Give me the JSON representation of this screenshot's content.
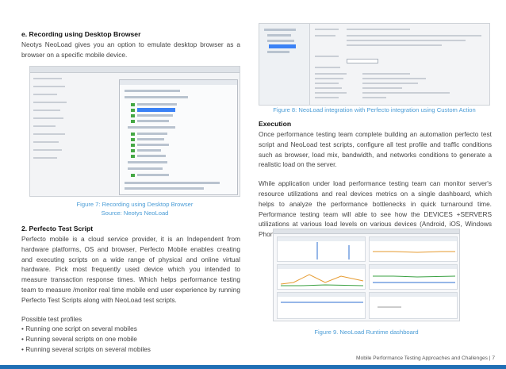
{
  "left": {
    "section_e_title": "e. Recording using Desktop Browser",
    "section_e_body": "Neotys NeoLoad gives you an option to emulate desktop browser as a browser on a specific mobile device.",
    "fig7_caption_line1": "Figure 7: Recording using Desktop Browser",
    "fig7_caption_line2": "Source: Neotys NeoLoad",
    "section_2_title": "2. Perfecto Test Script",
    "section_2_body": "Perfecto mobile is a cloud service provider, it is an Independent from hardware platforms, OS and browser, Perfecto Mobile enables creating and executing scripts on a wide range of physical and online virtual hardware. Pick most frequently used device which you intended to measure transaction response times. Which helps performance testing team to measure /monitor real time mobile end user experience by running Perfecto Test Scripts along with NeoLoad test scripts.",
    "profiles_title": "Possible test profiles",
    "profiles": [
      "Running one script on several mobiles",
      "Running several scripts on one mobile",
      "Running several scripts on several mobiles"
    ]
  },
  "right": {
    "fig8_caption": "Figure 8:  NeoLoad integration with Perfecto integration using Custom Action",
    "execution_title": "Execution",
    "execution_body1": "Once performance testing team complete building an automation perfecto test script and NeoLoad test scripts, configure all test profile and traffic conditions such as browser, load mix, bandwidth, and networks conditions to generate a realistic load on the server.",
    "execution_body2": "While application under load performance testing team can monitor server's resource utilizations and real devices metrics on a single dashboard, which helps to analyze the performance bottlenecks in quick turnaround time. Performance testing team will able to see how the DEVICES +SERVERS utilizations at various load levels on various devices (Android, iOS, Windows Phone, BlackBerry etc.).",
    "fig9_caption": "Figure 9. NeoLoad Runtime dashboard"
  },
  "footer": {
    "text": "Mobile Performance Testing Approaches and Challenges | 7"
  },
  "colors": {
    "accent": "#4a9cd6",
    "band": "#1f6fb5"
  }
}
